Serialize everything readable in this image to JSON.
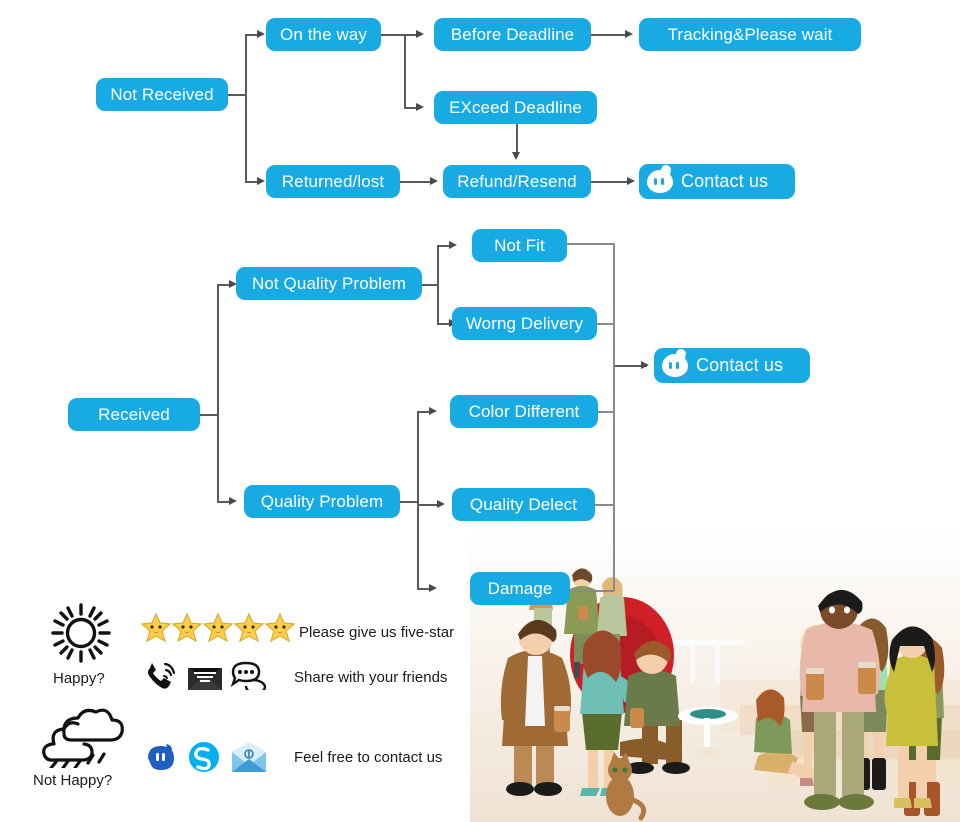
{
  "theme": {
    "node_blue": "#18ABE3",
    "node_text": "#ffffff",
    "wire": "#5a5a5a",
    "page_bg": "#ffffff",
    "body_text": "#1b1b1b",
    "star_fill": "#FBD14B",
    "skype_blue": "#00AFF0",
    "tm_blue": "#1F5FBF"
  },
  "flow_not_received": {
    "root": "Not Received",
    "branch_on_the_way": "On the way",
    "before_deadline": "Before Deadline",
    "tracking": "Tracking&Please wait",
    "exceed_deadline": "EXceed Deadline",
    "returned_lost": "Returned/lost",
    "refund_resend": "Refund/Resend",
    "contact": "Contact us"
  },
  "flow_received": {
    "root": "Received",
    "not_quality_problem": "Not Quality Problem",
    "not_fit": "Not Fit",
    "wrong_delivery": "Worng Delivery",
    "quality_problem": "Quality Problem",
    "color_different": "Color Different",
    "quality_defect": "Quality Delect",
    "damage": "Damage",
    "contact": "Contact us"
  },
  "feedback": {
    "happy_label": "Happy?",
    "not_happy_label": "Not Happy?",
    "five_star_text": "Please give us five-star",
    "share_text": "Share with your friends",
    "contact_text": "Feel free to contact us",
    "star_count": 5,
    "share_icons": [
      "phone-icon",
      "email-icon",
      "chat-icon"
    ],
    "contact_icons": [
      "trademanager-icon",
      "skype-icon",
      "email-envelope-icon"
    ],
    "happy_icon": "sun-icon",
    "not_happy_icon": "rain-cloud-icon"
  }
}
